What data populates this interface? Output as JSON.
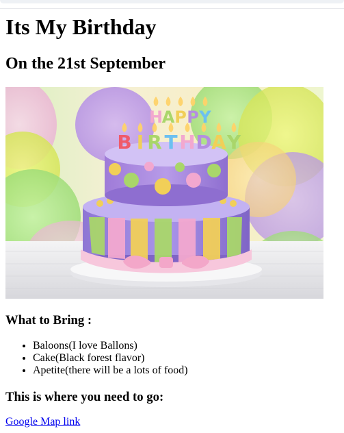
{
  "page": {
    "title": "Its My Birthday",
    "subtitle": "On the 21st September"
  },
  "image": {
    "icon": "birthday-cake-photo",
    "cake_topper_text": "HAPPY BIRTHDAY",
    "colors": {
      "cake_top": "#b48ee0",
      "cake_bottom": "#9e86e0",
      "stripe_yellow": "#f1cf58",
      "stripe_green": "#a9d66a",
      "stripe_pink": "#f2a8cf",
      "ribbon": "#f7c7dc"
    }
  },
  "bring": {
    "title": "What to Bring :",
    "items": [
      "Baloons(I love Ballons)",
      "Cake(Black forest flavor)",
      "Apetite(there will be a lots of food)"
    ]
  },
  "location": {
    "title": "This is where you need to go:",
    "link_label": "Google Map link",
    "link_color": "#0000ee"
  }
}
